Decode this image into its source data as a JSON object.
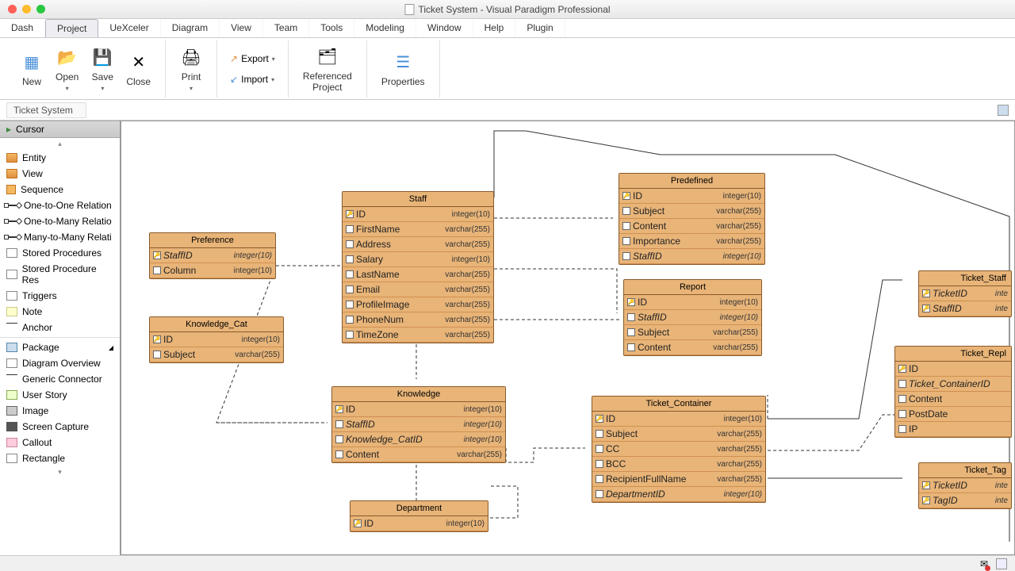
{
  "window": {
    "title": "Ticket System - Visual Paradigm Professional"
  },
  "menu": [
    "Dash",
    "Project",
    "UeXceler",
    "Diagram",
    "View",
    "Team",
    "Tools",
    "Modeling",
    "Window",
    "Help",
    "Plugin"
  ],
  "menu_active_index": 1,
  "ribbon": {
    "new": "New",
    "open": "Open",
    "save": "Save",
    "close": "Close",
    "print": "Print",
    "export": "Export",
    "import": "Import",
    "refproj": "Referenced\nProject",
    "props": "Properties"
  },
  "breadcrumb": "Ticket System",
  "palette": {
    "cursor": "Cursor",
    "items": [
      "Entity",
      "View",
      "Sequence",
      "One-to-One Relation",
      "One-to-Many Relatio",
      "Many-to-Many Relati",
      "Stored Procedures",
      "Stored Procedure Res",
      "Triggers",
      "Note",
      "Anchor",
      "Package",
      "Diagram Overview",
      "Generic Connector",
      "User Story",
      "Image",
      "Screen Capture",
      "Callout",
      "Rectangle"
    ]
  },
  "entities": {
    "preference": {
      "title": "Preference",
      "cols": [
        [
          "StaffID",
          "integer(10)",
          true
        ],
        [
          "Column",
          "integer(10)",
          false
        ]
      ]
    },
    "knowledge_cat": {
      "title": "Knowledge_Cat",
      "cols": [
        [
          "ID",
          "integer(10)",
          false
        ],
        [
          "Subject",
          "varchar(255)",
          false
        ]
      ]
    },
    "staff": {
      "title": "Staff",
      "cols": [
        [
          "ID",
          "integer(10)",
          false
        ],
        [
          "FirstName",
          "varchar(255)",
          false
        ],
        [
          "Address",
          "varchar(255)",
          false
        ],
        [
          "Salary",
          "integer(10)",
          false
        ],
        [
          "LastName",
          "varchar(255)",
          false
        ],
        [
          "Email",
          "varchar(255)",
          false
        ],
        [
          "ProfileImage",
          "varchar(255)",
          false
        ],
        [
          "PhoneNum",
          "varchar(255)",
          false
        ],
        [
          "TimeZone",
          "varchar(255)",
          false
        ]
      ]
    },
    "knowledge": {
      "title": "Knowledge",
      "cols": [
        [
          "ID",
          "integer(10)",
          false
        ],
        [
          "StaffID",
          "integer(10)",
          true
        ],
        [
          "Knowledge_CatID",
          "integer(10)",
          true
        ],
        [
          "Content",
          "varchar(255)",
          false
        ]
      ]
    },
    "department": {
      "title": "Department",
      "cols": [
        [
          "ID",
          "integer(10)",
          false
        ]
      ]
    },
    "predefined": {
      "title": "Predefined",
      "cols": [
        [
          "ID",
          "integer(10)",
          false
        ],
        [
          "Subject",
          "varchar(255)",
          false
        ],
        [
          "Content",
          "varchar(255)",
          false
        ],
        [
          "Importance",
          "varchar(255)",
          false
        ],
        [
          "StaffID",
          "integer(10)",
          true
        ]
      ]
    },
    "report": {
      "title": "Report",
      "cols": [
        [
          "ID",
          "integer(10)",
          false
        ],
        [
          "StaffID",
          "integer(10)",
          true
        ],
        [
          "Subject",
          "varchar(255)",
          false
        ],
        [
          "Content",
          "varchar(255)",
          false
        ]
      ]
    },
    "ticket_container": {
      "title": "Ticket_Container",
      "cols": [
        [
          "ID",
          "integer(10)",
          false
        ],
        [
          "Subject",
          "varchar(255)",
          false
        ],
        [
          "CC",
          "varchar(255)",
          false
        ],
        [
          "BCC",
          "varchar(255)",
          false
        ],
        [
          "RecipientFullName",
          "varchar(255)",
          false
        ],
        [
          "DepartmentID",
          "integer(10)",
          true
        ]
      ]
    },
    "ticket_staff": {
      "title": "Ticket_Staff",
      "cols": [
        [
          "TicketID",
          "inte",
          true
        ],
        [
          "StaffID",
          "inte",
          true
        ]
      ]
    },
    "ticket_repl": {
      "title": "Ticket_Repl",
      "cols": [
        [
          "ID",
          "",
          false
        ],
        [
          "Ticket_ContainerID",
          "",
          true
        ],
        [
          "Content",
          "",
          false
        ],
        [
          "PostDate",
          "",
          false
        ],
        [
          "IP",
          "",
          false
        ]
      ]
    },
    "ticket_tag": {
      "title": "Ticket_Tag",
      "cols": [
        [
          "TicketID",
          "inte",
          true
        ],
        [
          "TagID",
          "inte",
          true
        ]
      ]
    }
  }
}
